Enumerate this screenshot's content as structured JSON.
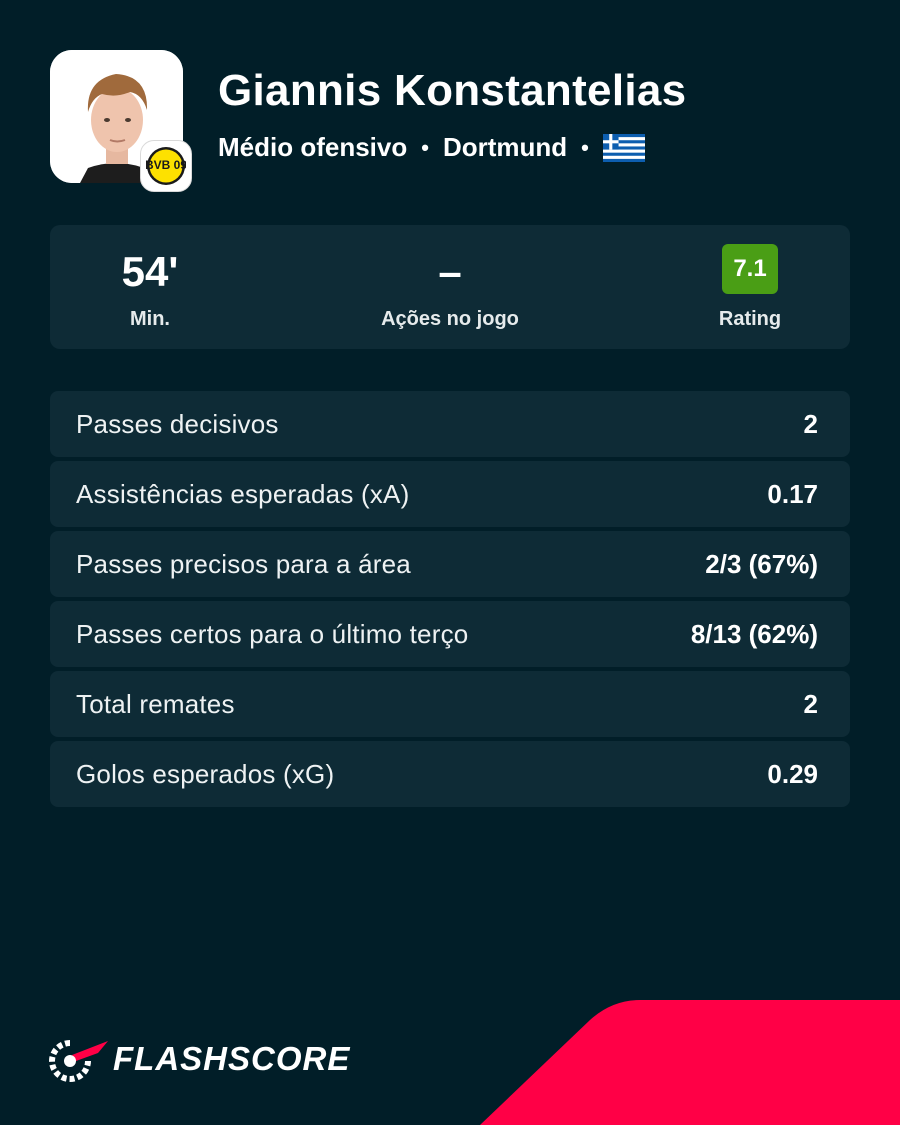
{
  "player": {
    "name": "Giannis Konstantelias",
    "position": "Médio ofensivo",
    "separator": "•",
    "club": "Dortmund",
    "nationality_flag": "greece-flag-icon",
    "club_badge": "bvb-badge-icon",
    "club_badge_text": "BVB 09"
  },
  "summary": {
    "minutes": {
      "value": "54'",
      "label": "Min."
    },
    "actions": {
      "value": "–",
      "label": "Ações no jogo"
    },
    "rating": {
      "value": "7.1",
      "label": "Rating",
      "color": "#4a9e15"
    }
  },
  "stats": [
    {
      "label": "Passes decisivos",
      "value": "2"
    },
    {
      "label": "Assistências esperadas (xA)",
      "value": "0.17"
    },
    {
      "label": "Passes precisos para a área",
      "value": "2/3 (67%)"
    },
    {
      "label": "Passes certos para o último terço",
      "value": "8/13 (62%)"
    },
    {
      "label": "Total remates",
      "value": "2"
    },
    {
      "label": "Golos esperados (xG)",
      "value": "0.29"
    }
  ],
  "brand": {
    "name": "FLASHSCORE",
    "logo": "flashscore-logo-icon",
    "accent_color": "#ff0046"
  },
  "colors": {
    "background": "#011e28",
    "card": "#0e2b36"
  }
}
